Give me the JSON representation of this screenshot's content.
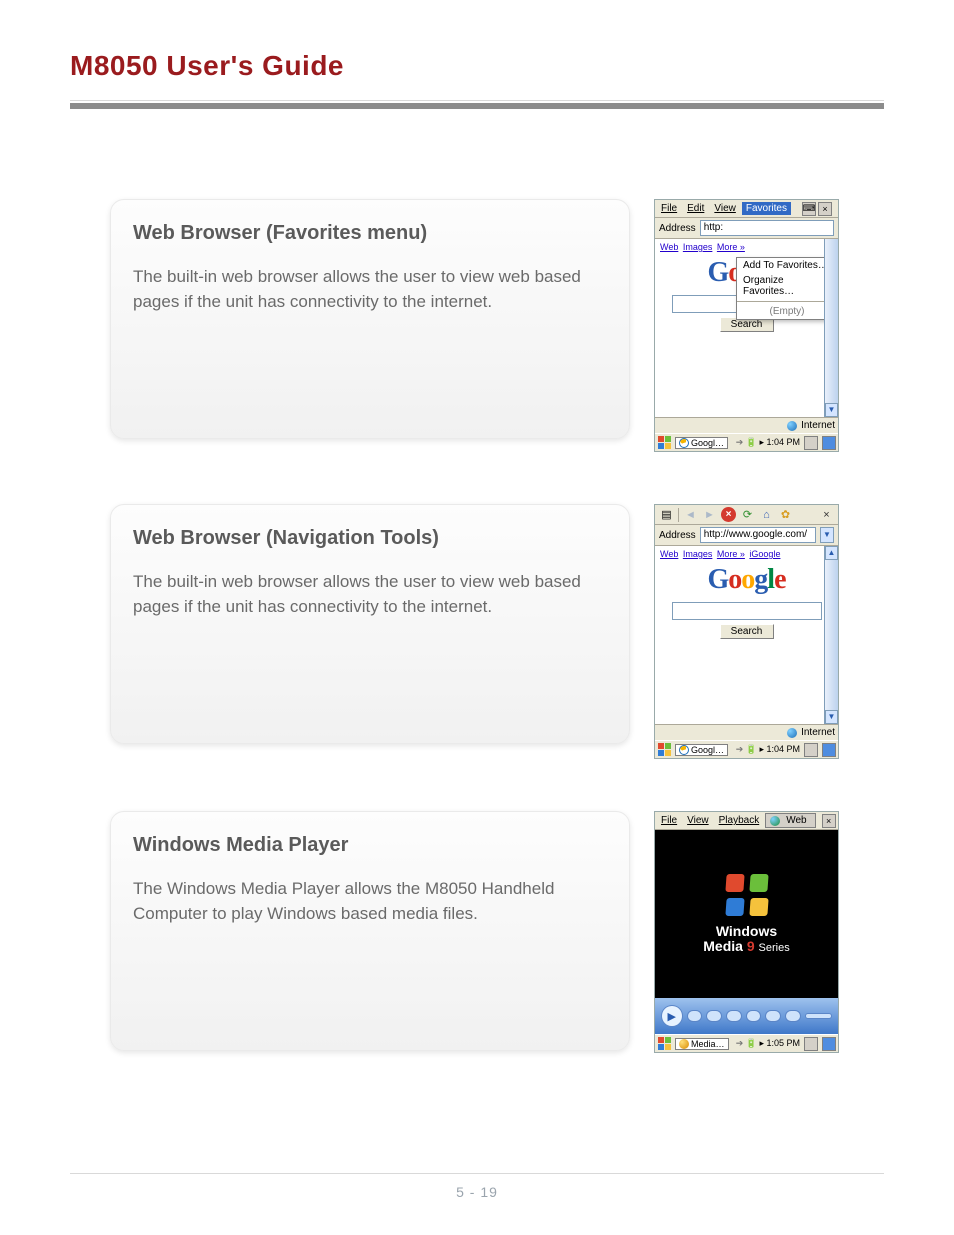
{
  "page_title": "M8050 User's Guide",
  "page_number": "5 - 19",
  "sections": [
    {
      "heading": "Web Browser (Favorites menu)",
      "body": "The built-in web browser allows the user to view web based pages if the unit has connectivity to the internet."
    },
    {
      "heading": "Web Browser (Navigation Tools)",
      "body": "The built-in web browser allows the user to view web based pages if the unit has connectivity to the internet."
    },
    {
      "heading": "Windows Media Player",
      "body": "The Windows Media Player allows the M8050 Handheld Computer to play Windows based media files."
    }
  ],
  "shots": {
    "browser_fav": {
      "menus": {
        "file": "File",
        "edit": "Edit",
        "view": "View",
        "favorites": "Favorites"
      },
      "close_glyph": "×",
      "keyboard_glyph": "⌨",
      "address_label": "Address",
      "address_value": "http:",
      "fav_menu": {
        "add": "Add To Favorites…",
        "organize": "Organize Favorites…",
        "empty": "(Empty)"
      },
      "toplinks": {
        "web": "Web",
        "images": "Images",
        "more": "More »"
      },
      "search_btn": "Search",
      "status_text": "Internet",
      "task_label": "Googl…",
      "time": "1:04 PM"
    },
    "browser_nav": {
      "close_glyph": "×",
      "address_label": "Address",
      "address_value": "http://www.google.com/",
      "toplinks": {
        "web": "Web",
        "images": "Images",
        "more": "More »",
        "igoogle": "iGoogle"
      },
      "search_btn": "Search",
      "status_text": "Internet",
      "task_label": "Googl…",
      "time": "1:04 PM"
    },
    "wmp": {
      "menus": {
        "file": "File",
        "view": "View",
        "playback": "Playback",
        "web": "Web"
      },
      "close_glyph": "×",
      "brand_line1": "Windows",
      "brand_line2_a": "Media",
      "brand_line2_b": "9",
      "brand_line2_c": "Series",
      "task_label": "Media…",
      "time": "1:05 PM"
    }
  }
}
